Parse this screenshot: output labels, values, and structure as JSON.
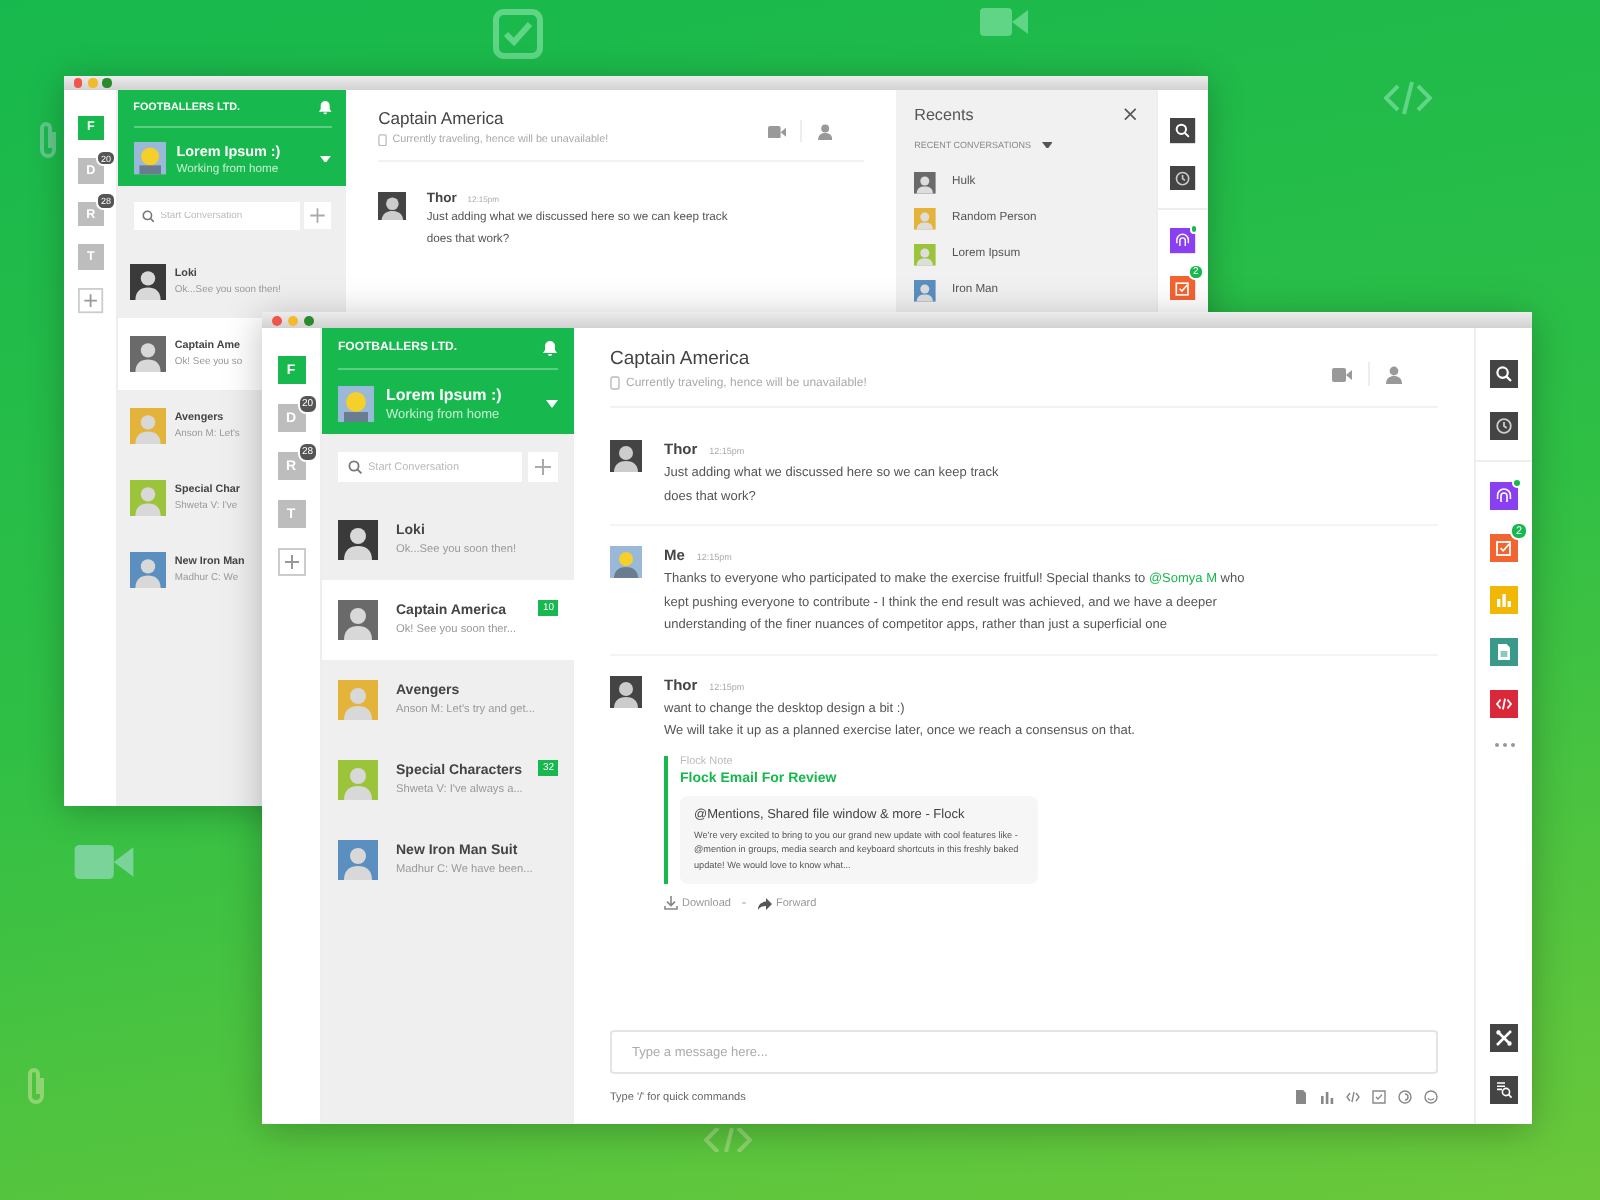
{
  "windows": [
    {
      "workspaces": [
        {
          "letter": "F",
          "selected": true
        },
        {
          "letter": "D",
          "selected": false,
          "badge": "20"
        },
        {
          "letter": "R",
          "selected": false,
          "badge": "28"
        },
        {
          "letter": "T",
          "selected": false
        }
      ],
      "sidebar": {
        "team": "FOOTBALLERS LTD.",
        "user": {
          "name": "Lorem Ipsum :)",
          "status": "Working from home"
        },
        "search": {
          "placeholder": "Start Conversation"
        },
        "conversations": [
          {
            "name": "Loki",
            "preview": "Ok...See you soon then!",
            "selected": false
          },
          {
            "name": "Captain Ame",
            "preview": "Ok! See you so",
            "selected": true
          },
          {
            "name": "Avengers",
            "preview": "Anson M: Let's",
            "selected": false
          },
          {
            "name": "Special Char",
            "preview": "Shweta V: I've",
            "selected": false
          },
          {
            "name": "New Iron Man",
            "preview": "Madhur C: We",
            "selected": false
          }
        ]
      },
      "chat": {
        "title": "Captain America",
        "status": "Currently traveling, hence will be unavailable!",
        "messages": [
          {
            "kind": "text",
            "author": "Thor",
            "time": "12:15pm",
            "lines": [
              "Just adding what we discussed here so we can keep track",
              "does that work?"
            ]
          }
        ]
      },
      "recents": {
        "title": "Recents",
        "section": "RECENT CONVERSATIONS",
        "people": [
          {
            "name": "Hulk"
          },
          {
            "name": "Random Person"
          },
          {
            "name": "Lorem Ipsum"
          },
          {
            "name": "Iron Man"
          }
        ]
      },
      "apps": [
        {
          "kind": "search",
          "color": "#444444"
        },
        {
          "kind": "clock",
          "color": "#444444"
        },
        {
          "kind": "notes",
          "color": "#8a3ff0",
          "online": true
        },
        {
          "kind": "todo",
          "color": "#f26430",
          "badge": "2"
        }
      ]
    },
    {
      "workspaces": [
        {
          "letter": "F",
          "selected": true
        },
        {
          "letter": "D",
          "selected": false,
          "badge": "20"
        },
        {
          "letter": "R",
          "selected": false,
          "badge": "28"
        },
        {
          "letter": "T",
          "selected": false
        }
      ],
      "sidebar": {
        "team": "FOOTBALLERS LTD.",
        "user": {
          "name": "Lorem Ipsum :)",
          "status": "Working from home"
        },
        "search": {
          "placeholder": "Start Conversation"
        },
        "conversations": [
          {
            "name": "Loki",
            "preview": "Ok...See you soon then!",
            "selected": false
          },
          {
            "name": "Captain America",
            "preview": "Ok! See you soon ther...",
            "selected": true,
            "badge": "10"
          },
          {
            "name": "Avengers",
            "preview": "Anson M: Let's try and get...",
            "selected": false
          },
          {
            "name": "Special Characters",
            "preview": "Shweta V: I've always a...",
            "selected": false,
            "badge": "32"
          },
          {
            "name": "New Iron Man Suit",
            "preview": "Madhur C: We have been...",
            "selected": false
          }
        ]
      },
      "chat": {
        "title": "Captain America",
        "status": "Currently traveling, hence will be unavailable!",
        "messages": [
          {
            "kind": "text",
            "author": "Thor",
            "time": "12:15pm",
            "lines": [
              "Just adding what we discussed here so we can keep track",
              "does that work?"
            ]
          },
          {
            "kind": "mention",
            "author": "Me",
            "time": "12:15pm",
            "before": "Thanks to everyone who participated to make the exercise fruitful! Special thanks to ",
            "mention": "@Somya M",
            "after": " who kept pushing everyone to contribute - I think the end result was achieved, and we have a deeper understanding of the finer nuances of competitor apps, rather than just a superficial one"
          },
          {
            "kind": "text",
            "author": "Thor",
            "time": "12:15pm",
            "lines": [
              "want to change the desktop design a bit :)",
              "We will take it up as a planned exercise later, once we reach a consensus on that."
            ],
            "attachment": {
              "label": "Flock Note",
              "title": "Flock Email For Review",
              "card_title": "@Mentions, Shared file window & more - Flock",
              "card_text": "We're very excited to bring to you our grand new update with cool features like - @mention in groups, media search and keyboard shortcuts in this freshly baked update! We would love to know what...",
              "actions": [
                {
                  "kind": "download",
                  "label": "Download"
                },
                {
                  "kind": "forward",
                  "label": "Forward"
                }
              ]
            }
          }
        ],
        "composer": {
          "placeholder": "Type a message here...",
          "hint": "Type '/' for quick commands",
          "tools": [
            {
              "kind": "file"
            },
            {
              "kind": "chart"
            },
            {
              "kind": "code"
            },
            {
              "kind": "todo"
            },
            {
              "kind": "notes"
            },
            {
              "kind": "emoji"
            }
          ]
        }
      },
      "apps": [
        {
          "kind": "search",
          "color": "#444444"
        },
        {
          "kind": "clock",
          "color": "#444444"
        },
        {
          "kind": "notes",
          "color": "#8a3ff0",
          "online": true
        },
        {
          "kind": "todo",
          "color": "#f26430",
          "badge": "2"
        },
        {
          "kind": "chart",
          "color": "#f2b705"
        },
        {
          "kind": "doc",
          "color": "#3a9a8a"
        },
        {
          "kind": "code",
          "color": "#d8283a"
        }
      ],
      "bottom_apps": [
        {
          "kind": "tools",
          "color": "#444444"
        },
        {
          "kind": "search-doc",
          "color": "#444444"
        }
      ]
    }
  ]
}
